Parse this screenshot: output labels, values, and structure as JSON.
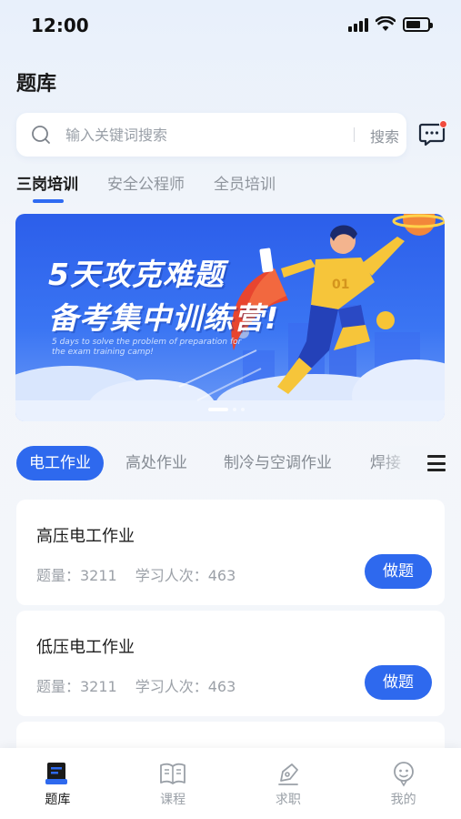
{
  "status_bar": {
    "time": "12:00"
  },
  "header": {
    "title": "题库"
  },
  "search": {
    "placeholder": "输入关键词搜索",
    "button_label": "搜索"
  },
  "tabs": [
    {
      "label": "三岗培训",
      "active": true
    },
    {
      "label": "安全公程师",
      "active": false
    },
    {
      "label": "全员培训",
      "active": false
    }
  ],
  "banner": {
    "title_line1": "5天攻克难题",
    "title_line2": "备考集中训练营!",
    "subtitle": "5 days to solve the problem of preparation for the exam training camp!",
    "jersey_number": "01",
    "slides_total": 3,
    "active_slide": 1
  },
  "categories": [
    {
      "label": "电工作业",
      "active": true
    },
    {
      "label": "高处作业",
      "active": false
    },
    {
      "label": "制冷与空调作业",
      "active": false
    },
    {
      "label": "焊接",
      "active": false
    }
  ],
  "practice_list": [
    {
      "title": "高压电工作业",
      "count_label": "题量：3211",
      "learners_label": "学习人次：463",
      "button": "做题"
    },
    {
      "title": "低压电工作业",
      "count_label": "题量：3211",
      "learners_label": "学习人次：463",
      "button": "做题"
    }
  ],
  "bottom_nav": [
    {
      "label": "题库",
      "icon": "question-bank-icon",
      "active": true
    },
    {
      "label": "课程",
      "icon": "book-icon",
      "active": false
    },
    {
      "label": "求职",
      "icon": "pen-icon",
      "active": false
    },
    {
      "label": "我的",
      "icon": "profile-icon",
      "active": false
    }
  ],
  "colors": {
    "primary": "#2e69ee",
    "badge": "#f04b3e"
  }
}
